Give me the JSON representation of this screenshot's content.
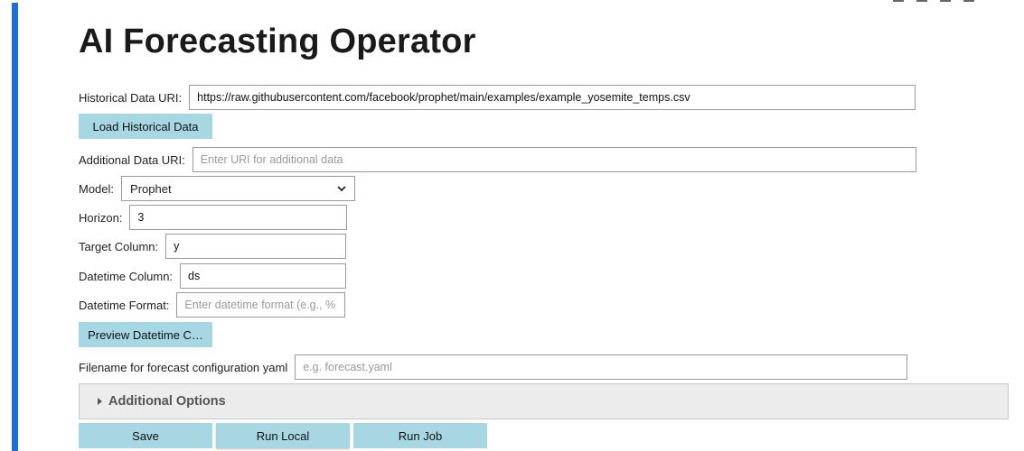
{
  "page": {
    "title": "AI Forecasting Operator"
  },
  "historical": {
    "label": "Historical Data URI:",
    "value": "https://raw.githubusercontent.com/facebook/prophet/main/examples/example_yosemite_temps.csv",
    "load_button": "Load Historical Data"
  },
  "additional": {
    "label": "Additional Data URI:",
    "placeholder": "Enter URI for additional data"
  },
  "model": {
    "label": "Model:",
    "value": "Prophet"
  },
  "horizon": {
    "label": "Horizon:",
    "value": "3"
  },
  "target": {
    "label": "Target Column:",
    "value": "y"
  },
  "datetime_column": {
    "label": "Datetime Column:",
    "value": "ds"
  },
  "datetime_format": {
    "label": "Datetime Format:",
    "placeholder": "Enter datetime format (e.g., %",
    "preview_button": "Preview Datetime C…"
  },
  "filename": {
    "label": "Filename for forecast configuration yaml",
    "placeholder": "e.g. forecast.yaml"
  },
  "additional_options": {
    "label": "Additional Options"
  },
  "actions": {
    "save": "Save",
    "run_local": "Run Local",
    "run_job": "Run Job"
  },
  "colors": {
    "accent_bar": "#1f6fd1",
    "button_bg": "#a7d7e3"
  }
}
